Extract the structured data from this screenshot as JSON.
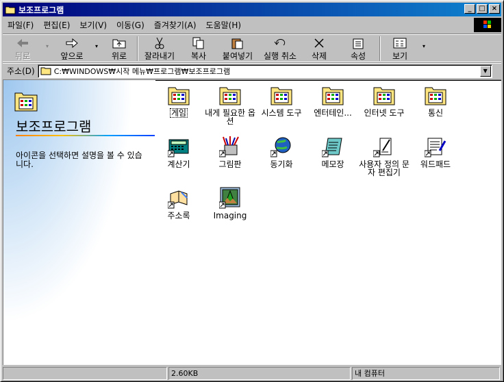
{
  "window": {
    "title": "보조프로그램"
  },
  "menubar": [
    {
      "label": "파일(F)"
    },
    {
      "label": "편집(E)"
    },
    {
      "label": "보기(V)"
    },
    {
      "label": "이동(G)"
    },
    {
      "label": "즐겨찾기(A)"
    },
    {
      "label": "도움말(H)"
    }
  ],
  "toolbar": {
    "back": "뒤로",
    "forward": "앞으로",
    "up": "위로",
    "cut": "잘라내기",
    "copy": "복사",
    "paste": "붙여넣기",
    "undo": "실행 취소",
    "delete": "삭제",
    "properties": "속성",
    "views": "보기"
  },
  "address": {
    "label": "주소(D)",
    "value": "C:₩WINDOWS₩시작 메뉴₩프로그램₩보조프로그램"
  },
  "leftpane": {
    "title": "보조프로그램",
    "description": "아이콘을 선택하면 설명을 볼 수 있습니다."
  },
  "items": [
    {
      "label": "게임",
      "icon": "folder-programs-icon"
    },
    {
      "label": "내게 필요한 옵션",
      "icon": "folder-programs-icon"
    },
    {
      "label": "시스템 도구",
      "icon": "folder-programs-icon"
    },
    {
      "label": "엔터테인...",
      "icon": "folder-programs-icon"
    },
    {
      "label": "인터넷 도구",
      "icon": "folder-programs-icon"
    },
    {
      "label": "통신",
      "icon": "folder-programs-icon"
    },
    {
      "label": "계산기",
      "icon": "calculator-icon"
    },
    {
      "label": "그림판",
      "icon": "paint-icon"
    },
    {
      "label": "동기화",
      "icon": "synchronize-icon"
    },
    {
      "label": "메모장",
      "icon": "notepad-icon"
    },
    {
      "label": "사용자 정의 문자 편집기",
      "icon": "char-editor-icon"
    },
    {
      "label": "워드패드",
      "icon": "wordpad-icon"
    },
    {
      "label": "주소록",
      "icon": "address-book-icon"
    },
    {
      "label": "Imaging",
      "icon": "imaging-icon"
    }
  ],
  "status": {
    "size": "2.60KB",
    "location": "내 컴퓨터"
  }
}
